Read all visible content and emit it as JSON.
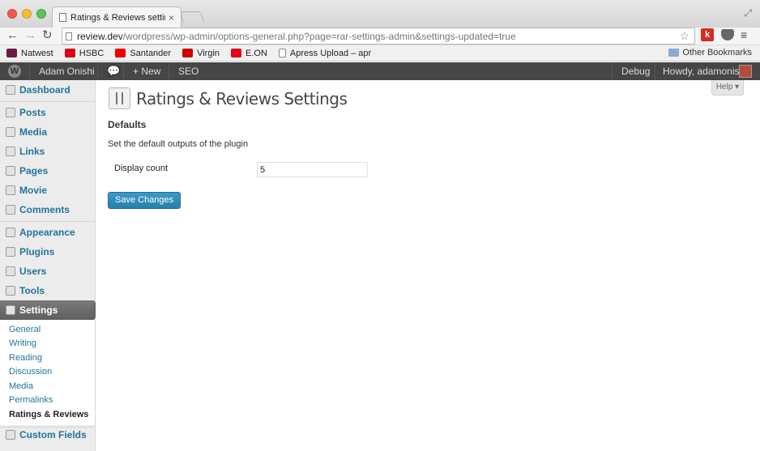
{
  "browser": {
    "tab_title": "Ratings & Reviews settings",
    "tab_close": "×",
    "url_host": "review.dev",
    "url_path": "/wordpress/wp-admin/options-general.php?page=rar-settings-admin&settings-updated=true",
    "ext_k_label": "k",
    "bookmarks": [
      {
        "label": "Natwest",
        "color": "#6d1b45"
      },
      {
        "label": "HSBC",
        "color": "#db0011"
      },
      {
        "label": "Santander",
        "color": "#ec0000"
      },
      {
        "label": "Virgin",
        "color": "#cc0000"
      },
      {
        "label": "E.ON",
        "color": "#e2001a"
      },
      {
        "label": "Apress Upload – apr",
        "color": "#ffffff"
      }
    ],
    "other_bookmarks": "Other Bookmarks"
  },
  "adminbar": {
    "site_name": "Adam Onishi",
    "new_label": "+ New",
    "seo_label": "SEO",
    "debug_label": "Debug",
    "howdy_label": "Howdy, adamonishi"
  },
  "sidebar": {
    "items": [
      {
        "label": "Dashboard",
        "icon": "dashboard-icon"
      },
      {
        "label": "Posts",
        "icon": "pin-icon"
      },
      {
        "label": "Media",
        "icon": "media-icon"
      },
      {
        "label": "Links",
        "icon": "link-icon"
      },
      {
        "label": "Pages",
        "icon": "pages-icon"
      },
      {
        "label": "Movie",
        "icon": "pin-icon"
      },
      {
        "label": "Comments",
        "icon": "comment-icon"
      },
      {
        "label": "Appearance",
        "icon": "appearance-icon"
      },
      {
        "label": "Plugins",
        "icon": "plugin-icon"
      },
      {
        "label": "Users",
        "icon": "users-icon"
      },
      {
        "label": "Tools",
        "icon": "tools-icon"
      },
      {
        "label": "Settings",
        "icon": "settings-icon"
      },
      {
        "label": "Custom Fields",
        "icon": "custom-fields-icon"
      }
    ],
    "submenu": [
      "General",
      "Writing",
      "Reading",
      "Discussion",
      "Media",
      "Permalinks",
      "Ratings & Reviews"
    ]
  },
  "main": {
    "help_label": "Help ▾",
    "page_title": "Ratings & Reviews Settings",
    "section_title": "Defaults",
    "section_desc": "Set the default outputs of the plugin",
    "field_label": "Display count",
    "field_value": "5",
    "save_label": "Save Changes"
  },
  "colors": {
    "link": "#21759b",
    "adminbar": "#464646",
    "button": "#2880aa"
  }
}
